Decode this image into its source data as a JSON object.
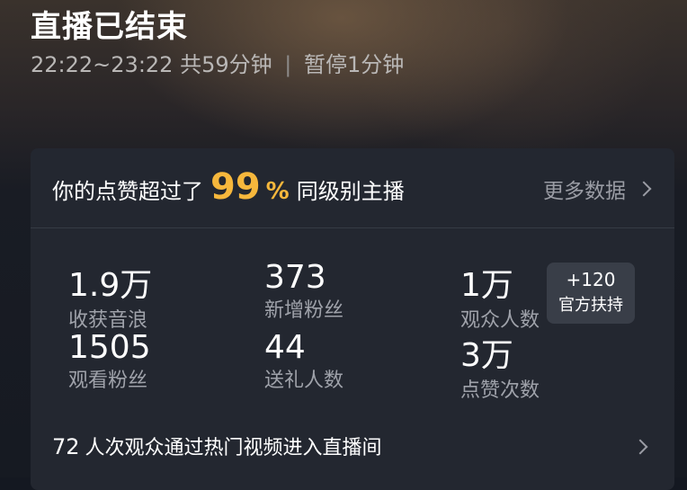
{
  "header": {
    "title": "直播已结束",
    "time_range": "22:22~23:22",
    "duration": "共59分钟",
    "separator": "|",
    "pause": "暂停1分钟"
  },
  "summary": {
    "prefix": "你的点赞超过了",
    "percent_value": "99",
    "percent_sign": "%",
    "suffix": "同级别主播",
    "more_label": "更多数据"
  },
  "stats": [
    {
      "value": "1.9万",
      "label": "收获音浪"
    },
    {
      "value": "373",
      "label": "新增粉丝"
    },
    {
      "value": "1万",
      "label": "观众人数"
    },
    {
      "value": "1505",
      "label": "观看粉丝"
    },
    {
      "value": "44",
      "label": "送礼人数"
    },
    {
      "value": "3万",
      "label": "点赞次数"
    }
  ],
  "badge": {
    "value": "+120",
    "label": "官方扶持"
  },
  "footer": {
    "count": "72",
    "text": "人次观众通过热门视频进入直播间"
  },
  "colors": {
    "accent": "#f6b73c",
    "card_bg": "#232730",
    "label_gray": "#9fa2aa"
  }
}
